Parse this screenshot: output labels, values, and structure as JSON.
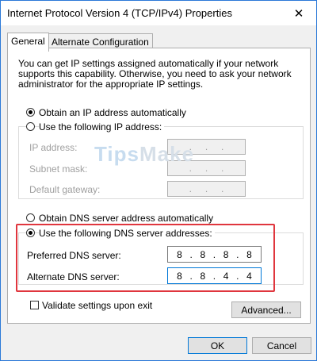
{
  "window": {
    "title": "Internet Protocol Version 4 (TCP/IPv4) Properties",
    "close_glyph": "✕"
  },
  "tabs": [
    {
      "label": "General",
      "active": true
    },
    {
      "label": "Alternate Configuration",
      "active": false
    }
  ],
  "general": {
    "description": "You can get IP settings assigned automatically if your network supports this capability. Otherwise, you need to ask your network administrator for the appropriate IP settings.",
    "ip_mode": {
      "auto_label": "Obtain an IP address automatically",
      "manual_label": "Use the following IP address:",
      "selected": "auto"
    },
    "ip_fields": [
      {
        "label": "IP address:",
        "octets": [
          "",
          "",
          "",
          ""
        ]
      },
      {
        "label": "Subnet mask:",
        "octets": [
          "",
          "",
          "",
          ""
        ]
      },
      {
        "label": "Default gateway:",
        "octets": [
          "",
          "",
          "",
          ""
        ]
      }
    ],
    "dns_mode": {
      "auto_label": "Obtain DNS server address automatically",
      "manual_label": "Use the following DNS server addresses:",
      "selected": "manual"
    },
    "dns_fields": [
      {
        "label": "Preferred DNS server:",
        "octets": [
          "8",
          "8",
          "8",
          "8"
        ]
      },
      {
        "label": "Alternate DNS server:",
        "octets": [
          "8",
          "8",
          "4",
          "4"
        ]
      }
    ],
    "validate_label": "Validate settings upon exit",
    "validate_checked": false,
    "advanced_label": "Advanced..."
  },
  "footer": {
    "ok_label": "OK",
    "cancel_label": "Cancel"
  },
  "watermark": {
    "part1": "Tips",
    "part2": "Make"
  },
  "colors": {
    "highlight": "#e0363e",
    "focus": "#0078d7",
    "disabled_text": "#a0a0a0"
  }
}
